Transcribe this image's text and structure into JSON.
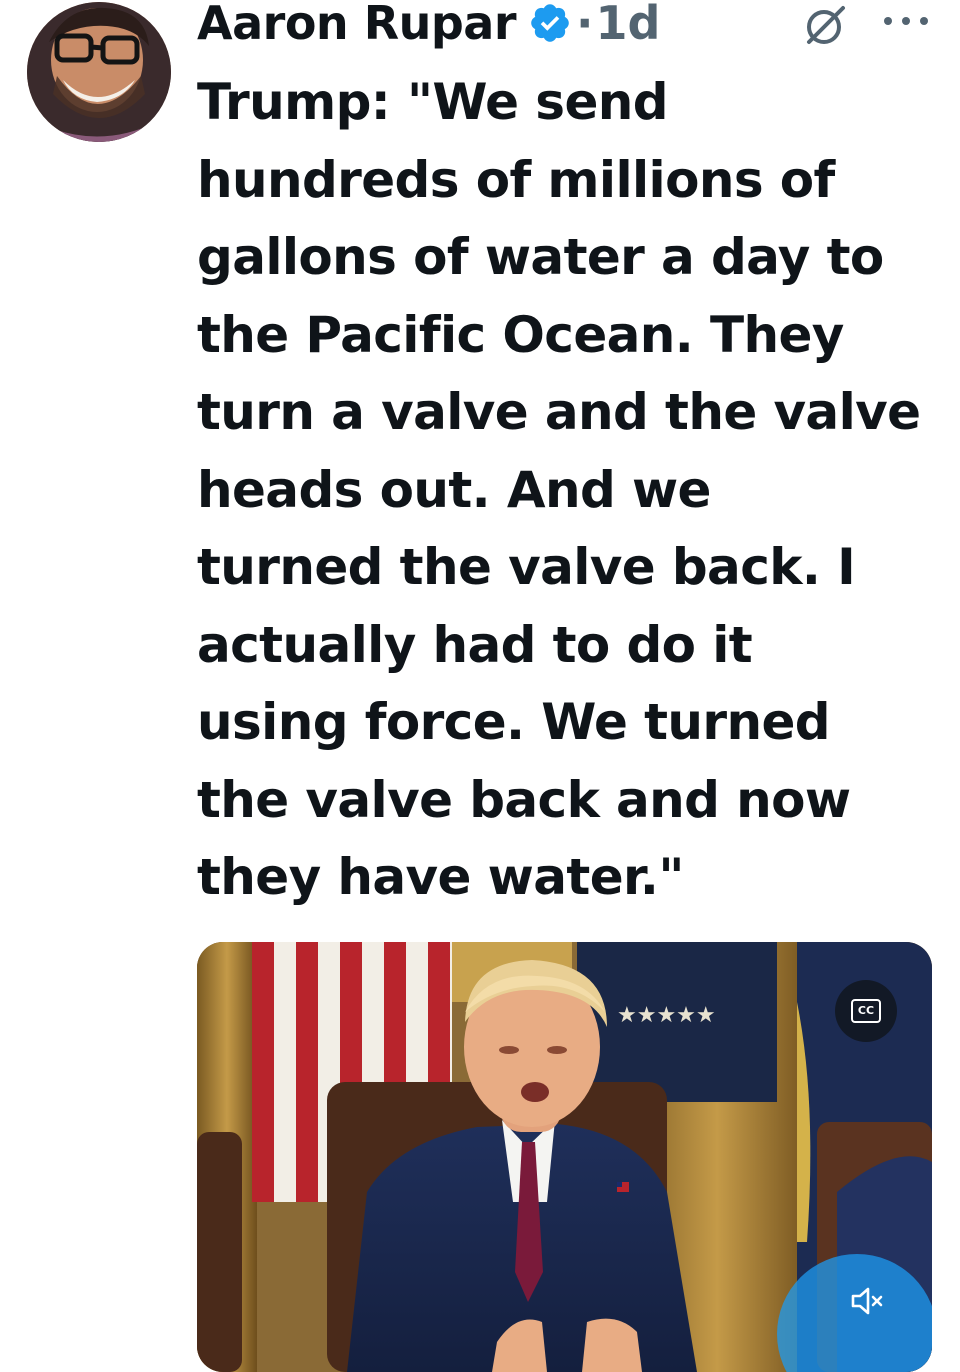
{
  "author": {
    "name": "Aaron Rupar",
    "verified": true,
    "separator": "·",
    "time": "1d"
  },
  "tweet": {
    "text": "Trump: \"We send\nhundreds of millions of\ngallons of water a day to\nthe Pacific Ocean. They\nturn a valve and the valve\nheads out. And we\nturned the valve back. I\nactually had to do it\nusing force. We turned\nthe valve back and now\nthey have water.\""
  },
  "media": {
    "type": "video",
    "captions_label": "CC"
  },
  "colors": {
    "text": "#0f1419",
    "secondary": "#536471",
    "verified_blue": "#1d9bf0"
  },
  "icons": [
    "avatar",
    "verified-badge-icon",
    "grok-icon",
    "more-icon",
    "captions-icon",
    "mute-icon"
  ]
}
